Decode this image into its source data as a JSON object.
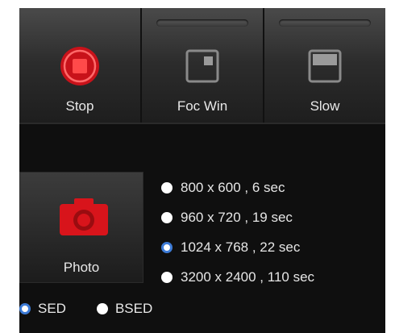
{
  "toolbar": {
    "buttons": [
      {
        "label": "Stop",
        "icon": "stop-icon"
      },
      {
        "label": "Foc Win",
        "icon": "focus-window-icon"
      },
      {
        "label": "Slow",
        "icon": "slow-scan-icon"
      }
    ]
  },
  "capture": {
    "photo_label": "Photo",
    "photo_icon": "camera-icon",
    "resolutions": [
      {
        "label": "800 x 600 ,  6 sec",
        "selected": false
      },
      {
        "label": "960 x 720 ,  19 sec",
        "selected": false
      },
      {
        "label": "1024 x 768 ,  22 sec",
        "selected": true
      },
      {
        "label": "3200 x 2400 ,  110 sec",
        "selected": false
      }
    ]
  },
  "detector": {
    "options": [
      {
        "label": "SED",
        "selected": true
      },
      {
        "label": "BSED",
        "selected": false
      }
    ]
  },
  "colors": {
    "accent_red": "#d8141b",
    "radio_selected": "#3d7bd6",
    "panel_bg": "#0f0f0f"
  }
}
